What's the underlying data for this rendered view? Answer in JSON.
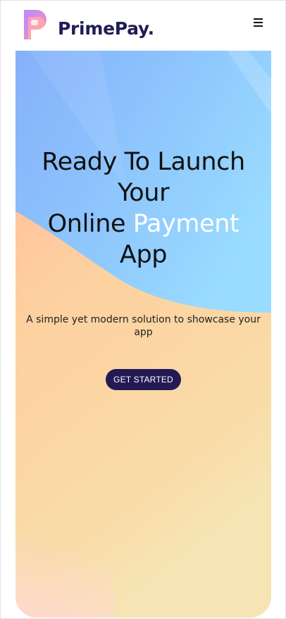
{
  "header": {
    "brand_name": "PrimePay.",
    "menu_icon": "hamburger-menu-icon"
  },
  "hero": {
    "headline_line1": "Ready To Launch",
    "headline_line2": "Your",
    "headline_online": "Online ",
    "headline_highlight": "Payment",
    "headline_line4": "App",
    "subtext": "A simple yet modern solution to showcase your app",
    "cta_label": "GET STARTED"
  },
  "colors": {
    "brand_text": "#1f1c56",
    "cta_background": "#231a54",
    "hero_blue": "#8fc3fb",
    "hero_peach": "#fcc29e",
    "highlight_text": "#ffffff"
  }
}
